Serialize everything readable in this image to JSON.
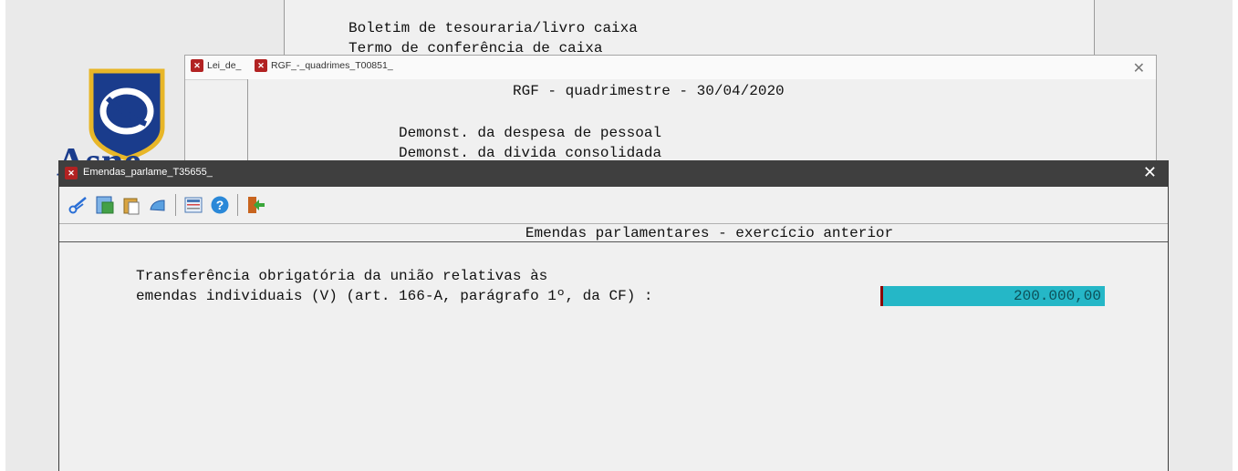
{
  "back_window": {
    "menu_items": [
      "Boletim de tesouraria/livro caixa",
      "Termo de conferência de caixa"
    ]
  },
  "logo": {
    "text": "Asne"
  },
  "middle_window": {
    "tab_left": "Lei_de_",
    "tab_right": "RGF_-_quadrimes_T00851_",
    "title": "RGF - quadrimestre - 30/04/2020",
    "items": [
      "Demonst. da despesa de pessoal",
      "Demonst. da divida consolidada"
    ]
  },
  "front_window": {
    "title": "Emendas_parlame_T35655_",
    "toolbar": {
      "icons": [
        "cut-icon",
        "save-icon",
        "paste-icon",
        "undo-icon",
        "calculator-icon",
        "help-icon",
        "exit-icon"
      ]
    },
    "section_title": "Emendas parlamentares - exercício anterior",
    "field_label_line1": "Transferência obrigatória da união relativas às",
    "field_label_line2": "emendas individuais (V) (art. 166-A, parágrafo 1º, da CF) :",
    "field_value": "200.000,00"
  },
  "colors": {
    "highlight": "#25b7c7",
    "titlebar_dark": "#3f3f3f",
    "window_bg": "#f0f0f0"
  }
}
